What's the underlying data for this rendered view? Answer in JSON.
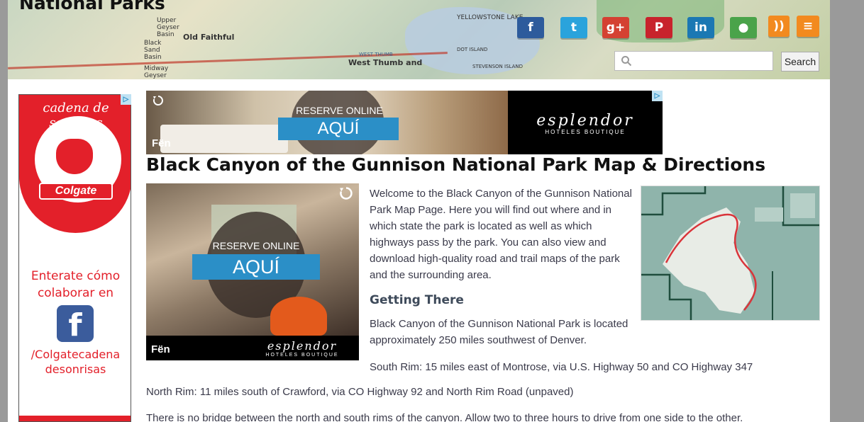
{
  "header": {
    "site_title": "National Parks",
    "map_labels": [
      "Old Faithful",
      "Upper Geyser Basin",
      "Black Sand Basin",
      "Midway Geyser Basin",
      "YELLOWSTONE LAKE",
      "West Thumb and",
      "STEVENSON ISLAND",
      "DOT ISLAND",
      "WEST THUMB"
    ],
    "social_icons": [
      {
        "name": "facebook",
        "glyph": "f",
        "color": "#2d5b9c"
      },
      {
        "name": "twitter",
        "glyph": "t",
        "color": "#2aa3dc"
      },
      {
        "name": "google-plus",
        "glyph": "g+",
        "color": "#d44132"
      },
      {
        "name": "pinterest",
        "glyph": "P",
        "color": "#c8232c"
      },
      {
        "name": "linkedin",
        "glyph": "in",
        "color": "#1b78b3"
      },
      {
        "name": "other",
        "glyph": "●",
        "color": "#4aa34a"
      },
      {
        "name": "rss",
        "glyph": "))",
        "color": "#f28a1f"
      },
      {
        "name": "rss-comments",
        "glyph": "≡",
        "color": "#f28a1f"
      }
    ],
    "search": {
      "placeholder": "",
      "value": "",
      "button_label": "Search"
    }
  },
  "ads": {
    "left": {
      "arc_text": "cadena de sonrisas",
      "brand": "Colgate",
      "line1": "Enterate cómo",
      "line2": "colaborar en",
      "fb_glyph": "f",
      "handle1": "/Colgatecadena",
      "handle2": "desonrisas",
      "adchoice": "▷"
    },
    "banner": {
      "reserve": "RESERVE ONLINE",
      "cta": "AQUÍ",
      "brand": "esplendor",
      "sub": "HOTELES BOUTIQUE",
      "fen": "Fën",
      "adchoice": "▷"
    },
    "square": {
      "reserve": "RESERVE ONLINE",
      "cta": "AQUÍ",
      "brand": "esplendor",
      "sub": "HOTELES BOUTIQUE",
      "fen": "Fën"
    }
  },
  "article": {
    "title": "Black Canyon of the Gunnison National Park Map & Directions",
    "intro": "Welcome to the Black Canyon of the Gunnison National Park Map Page. Here you will find out where and in which state the park is located as well as which highways pass by the park. You can also view and download high-quality road and trail maps of the park and the surrounding area.",
    "getting_there_heading": "Getting There",
    "located": "Black Canyon of the Gunnison National Park is located approximately 250 miles southwest of Denver.",
    "south_rim": "South Rim: 15 miles east of Montrose, via U.S. Highway 50 and CO Highway 347",
    "north_rim": "North Rim: 11 miles south of Crawford, via CO Highway 92 and North Rim Road (unpaved)",
    "no_bridge": "There is no bridge between the north and south rims of the canyon. Allow two to three hours to drive from one side to the other."
  }
}
